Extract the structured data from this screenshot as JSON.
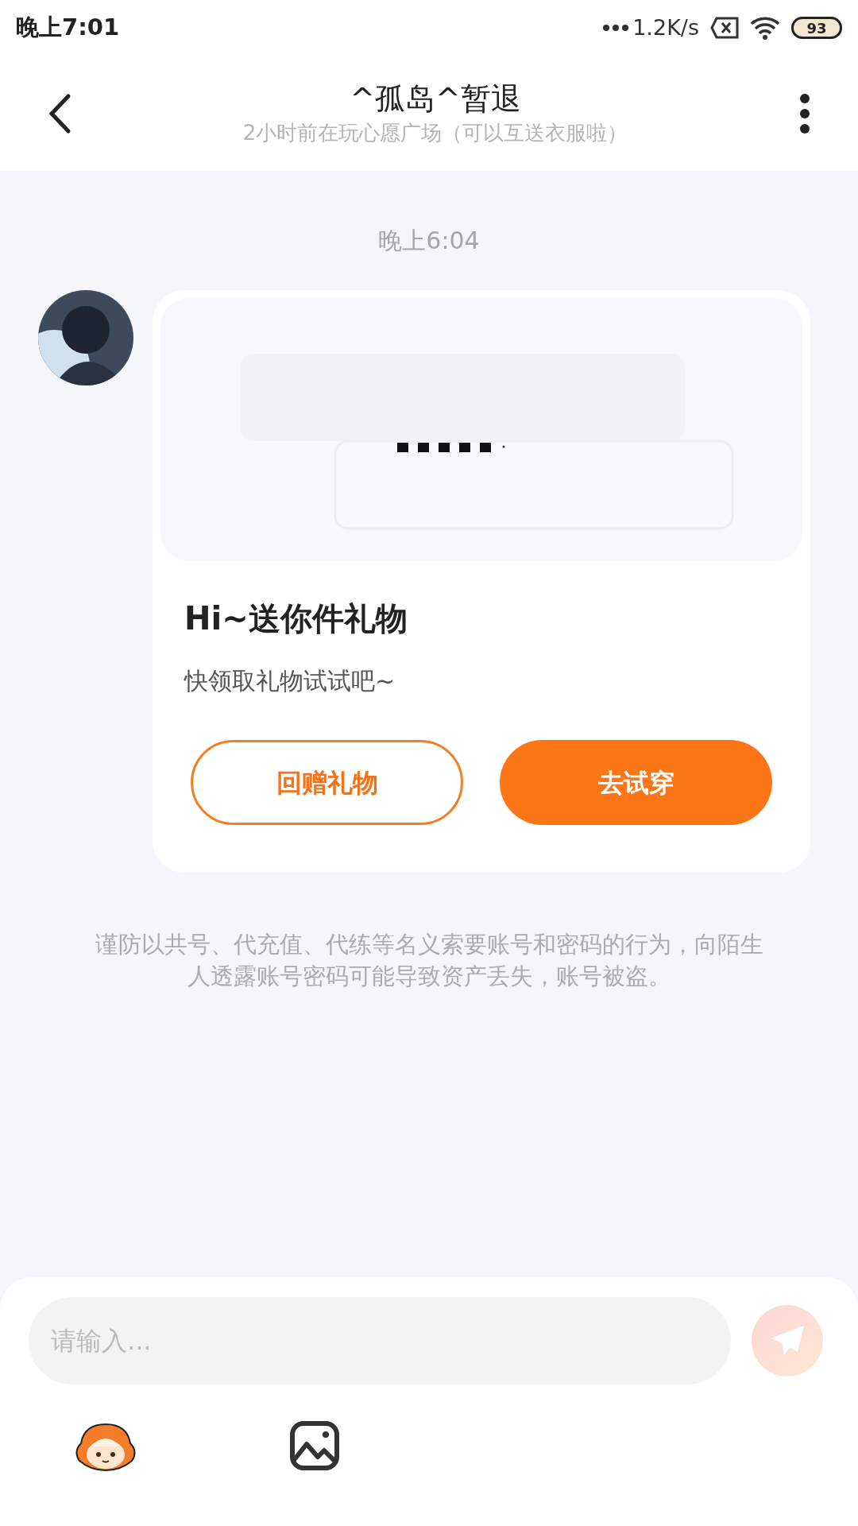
{
  "status_bar": {
    "time": "晚上7:01",
    "network_speed": "1.2K/s",
    "battery": "93"
  },
  "header": {
    "title": "^孤岛^暂退",
    "subtitle": "2小时前在玩心愿广场（可以互送衣服啦）"
  },
  "chat": {
    "timestamp": "晚上6:04",
    "message": {
      "kind": "picture",
      "title": "Hi~送你件礼物",
      "text": "快领取礼物试试吧~",
      "buttons": [
        {
          "label": "回赠礼物",
          "kind": "outline"
        },
        {
          "label": "去试穿",
          "kind": "filled"
        }
      ]
    },
    "notice": "谨防以共号、代充值、代练等名义索要账号和密码的行为，向陌生人透露账号密码可能导致资产丢失，账号被盗。"
  },
  "composer": {
    "placeholder": "请输入..."
  }
}
